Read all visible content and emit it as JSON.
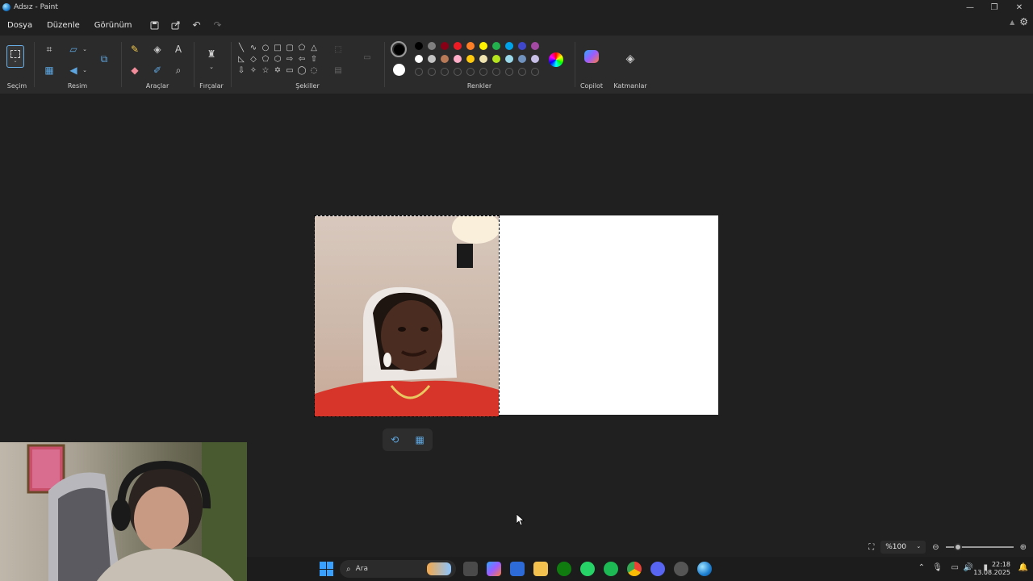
{
  "window": {
    "title": "Adsız - Paint"
  },
  "menu": {
    "items": [
      "Dosya",
      "Düzenle",
      "Görünüm"
    ]
  },
  "ribbon": {
    "groups": {
      "selection": "Seçim",
      "image": "Resim",
      "tools": "Araçlar",
      "brushes": "Fırçalar",
      "shapes": "Şekiller",
      "colors": "Renkler",
      "copilot": "Copilot",
      "layers": "Katmanlar"
    },
    "palette_row1": [
      "#000000",
      "#7f7f7f",
      "#880015",
      "#ed1c24",
      "#ff7f27",
      "#fff200",
      "#22b14c",
      "#00a2e8",
      "#3f48cc",
      "#a349a4"
    ],
    "palette_row2": [
      "#ffffff",
      "#c3c3c3",
      "#b97a57",
      "#ffaec9",
      "#ffc90e",
      "#efe4b0",
      "#b5e61d",
      "#99d9ea",
      "#7092be",
      "#c8bfe7"
    ],
    "primary_color": "#000000",
    "secondary_color": "#ffffff"
  },
  "status": {
    "zoom": "%100",
    "zoom_level_fraction": 0.18
  },
  "taskbar": {
    "search_label": "Ara",
    "time": "22:18",
    "date": "13.08.2025"
  }
}
